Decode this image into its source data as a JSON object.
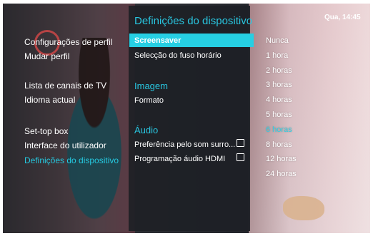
{
  "clock": "Qua, 14:45",
  "left_menu": [
    {
      "label": "Configurações de perfil",
      "active": false
    },
    {
      "label": "Mudar perfil",
      "active": false
    },
    {
      "label": "Lista de canais de TV",
      "active": false
    },
    {
      "label": "Idioma actual",
      "active": false
    },
    {
      "label": "Set-top box",
      "active": false
    },
    {
      "label": "Interface do utilizador",
      "active": false
    },
    {
      "label": "Definições do dispositivo",
      "active": true
    }
  ],
  "panel": {
    "title": "Definições do dispositivo",
    "items": [
      {
        "label": "Screensaver"
      },
      {
        "label": "Selecção do fuso horário"
      }
    ],
    "section_image": "Imagem",
    "format": "Formato",
    "section_audio": "Áudio",
    "audio_items": [
      {
        "label": "Preferência pelo som surro...",
        "checked": false
      },
      {
        "label": "Programação áudio HDMI",
        "checked": false
      }
    ]
  },
  "options": [
    {
      "label": "Nunca"
    },
    {
      "label": "1 hora"
    },
    {
      "label": "2 horas"
    },
    {
      "label": "3 horas"
    },
    {
      "label": "4 horas"
    },
    {
      "label": "5 horas"
    },
    {
      "label": "6 horas"
    },
    {
      "label": "8 horas"
    },
    {
      "label": "12 horas"
    },
    {
      "label": "24 horas"
    }
  ],
  "colors": {
    "accent": "#26cfe3",
    "panel": "#1e2026"
  }
}
